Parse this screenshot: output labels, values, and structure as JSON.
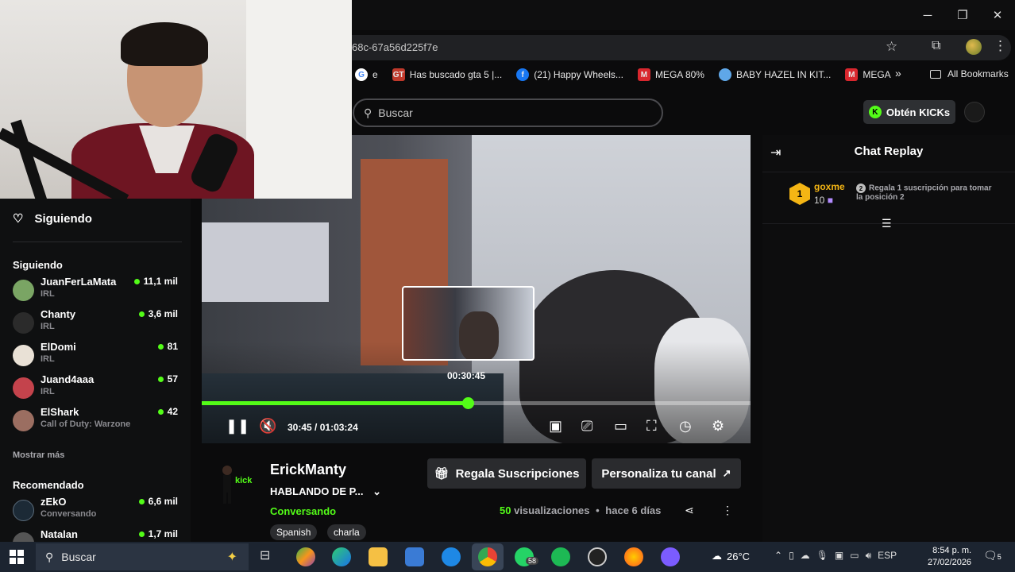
{
  "window": {
    "minimize_glyph": "─",
    "restore_glyph": "❐",
    "close_glyph": "✕"
  },
  "browser": {
    "url_fragment": "68c-67a56d225f7e",
    "bookmarks": [
      {
        "label": "e",
        "icon": "google-icon",
        "color": "#4285f4"
      },
      {
        "label": "Has buscado gta 5 |...",
        "icon": "gta-icon",
        "color": "#c0392b"
      },
      {
        "label": "(21) Happy Wheels...",
        "icon": "facebook-icon",
        "color": "#1877f2"
      },
      {
        "label": "MEGA 80%",
        "icon": "mega-icon",
        "color": "#d9272e"
      },
      {
        "label": "BABY HAZEL IN KIT...",
        "icon": "baby-hazel-icon",
        "color": "#5fa7e8"
      },
      {
        "label": "MEGA",
        "icon": "mega-icon",
        "color": "#d9272e"
      }
    ],
    "more_label": "»",
    "all_bookmarks_label": "All Bookmarks"
  },
  "kick": {
    "search_placeholder": "Buscar",
    "get_kicks_label": "Obtén KICKs",
    "sidebar": {
      "header": "Siguiendo",
      "section_following": "Siguiendo",
      "channels": [
        {
          "name": "JuanFerLaMata",
          "category": "IRL",
          "viewers": "11,1 mil",
          "avatar_color": "#7aa564"
        },
        {
          "name": "Chanty",
          "category": "IRL",
          "viewers": "3,6 mil",
          "avatar_color": "#2b2b2b"
        },
        {
          "name": "ElDomi",
          "category": "IRL",
          "viewers": "81",
          "avatar_color": "#e9e1d6"
        },
        {
          "name": "Juand4aaa",
          "category": "IRL",
          "viewers": "57",
          "avatar_color": "#c4434c"
        },
        {
          "name": "ElShark",
          "category": "Call of Duty: Warzone",
          "viewers": "42",
          "avatar_color": "#9b6e61"
        }
      ],
      "show_more": "Mostrar más",
      "section_recommended": "Recomendado",
      "recommended": [
        {
          "name": "zEkO",
          "category": "Conversando",
          "viewers": "6,6 mil",
          "avatar_color": "#1c2a36"
        },
        {
          "name": "Natalan",
          "category": "",
          "viewers": "1,7 mil",
          "avatar_color": "#555"
        }
      ]
    },
    "player": {
      "preview_time": "00:30:45",
      "current_time": "30:45",
      "separator": "/",
      "duration": "01:03:24",
      "progress_fraction": 0.485
    },
    "chat": {
      "title": "Chat Replay",
      "leader_rank": "1",
      "leader_name": "goxme",
      "leader_count": "10",
      "gift_rank": "2",
      "gift_note": "Regala 1 suscripción para tomar la posición 2"
    },
    "stream": {
      "streamer": "ErickManty",
      "title": "HABLANDO DE P...",
      "category": "Conversando",
      "tags": [
        "Spanish",
        "charla"
      ],
      "gift_button": "Regala Suscripciones",
      "customize_button": "Personaliza tu canal",
      "views_count": "50",
      "views_label": "visualizaciones",
      "dot": "•",
      "posted": "hace 6 días"
    },
    "accent_color": "#53fc18"
  },
  "taskbar": {
    "search_placeholder": "Buscar",
    "whatsapp_badge": "58",
    "weather": "26°C",
    "language": "ESP",
    "time": "8:54 p. m.",
    "date": "27/02/2026",
    "notif_count": "5"
  }
}
